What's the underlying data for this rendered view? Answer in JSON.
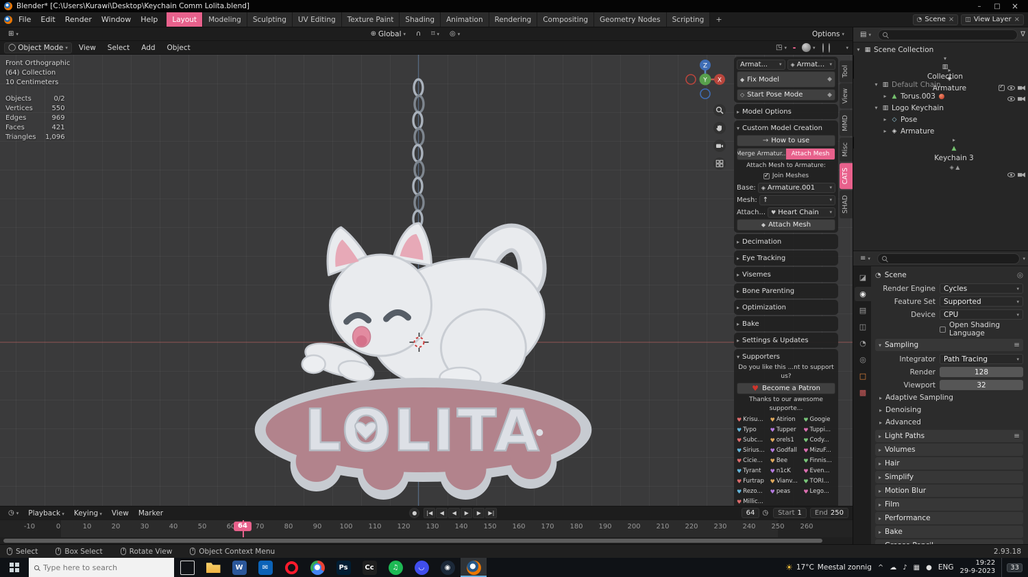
{
  "theme": {
    "accent": "#e8618c"
  },
  "titlebar": {
    "title": "Blender* [C:\\Users\\Kurawi\\Desktop\\Keychain Comm Lolita.blend]"
  },
  "topbar": {
    "menus": [
      {
        "label": "File"
      },
      {
        "label": "Edit"
      },
      {
        "label": "Render"
      },
      {
        "label": "Window"
      },
      {
        "label": "Help"
      }
    ],
    "workspaces": [
      {
        "label": "Layout",
        "active": true
      },
      {
        "label": "Modeling"
      },
      {
        "label": "Sculpting"
      },
      {
        "label": "UV Editing"
      },
      {
        "label": "Texture Paint"
      },
      {
        "label": "Shading"
      },
      {
        "label": "Animation"
      },
      {
        "label": "Rendering"
      },
      {
        "label": "Compositing"
      },
      {
        "label": "Geometry Nodes"
      },
      {
        "label": "Scripting"
      }
    ],
    "add_tab": "+",
    "scene_name": "Scene",
    "view_layer_name": "View Layer"
  },
  "viewport_header": {
    "orientation": "Global",
    "options_label": "Options",
    "mode": "Object Mode",
    "menus": [
      {
        "label": "View"
      },
      {
        "label": "Select"
      },
      {
        "label": "Add"
      },
      {
        "label": "Object"
      }
    ]
  },
  "viewport": {
    "view_label": "Front Orthographic",
    "collection_label": "(64) Collection",
    "scale_label": "10 Centimeters",
    "stats": [
      {
        "label": "Objects",
        "value": "0/2"
      },
      {
        "label": "Vertices",
        "value": "550"
      },
      {
        "label": "Edges",
        "value": "969"
      },
      {
        "label": "Faces",
        "value": "421"
      },
      {
        "label": "Triangles",
        "value": "1,096"
      }
    ],
    "axis_z": "Z",
    "axis_y": "Y",
    "axis_x": "X",
    "model_text": "LOLITA"
  },
  "cats_panel": {
    "armature_label": "Armat...",
    "armature_value": "Armature.001",
    "fix_model": "Fix Model",
    "start_pose_mode": "Start Pose Mode",
    "model_options": "Model Options",
    "custom_model_creation": "Custom Model Creation",
    "how_to_use": "How to use",
    "merge_tab": "Merge Armatur...",
    "attach_tab": "Attach Mesh",
    "attach_heading": "Attach Mesh to Armature:",
    "join_meshes": "Join Meshes",
    "base_label": "Base:",
    "base_value": "Armature.001",
    "mesh_label": "Mesh:",
    "mesh_value": "↑",
    "attach_label": "Attach...",
    "attach_value": "Heart Chain",
    "attach_button": "Attach Mesh",
    "collapsed_sections": [
      "Decimation",
      "Eye Tracking",
      "Visemes",
      "Bone Parenting",
      "Optimization",
      "Bake",
      "Settings & Updates"
    ],
    "supporters_section": "Supporters",
    "support_question": "Do you like this ...nt to support us?",
    "become_patron": "Become a Patron",
    "thanks_line": "Thanks to our awesome supporte...",
    "supporters": [
      "Krisu...",
      "Atirion",
      "Googie",
      "Typo",
      "Tupper",
      "Tuppi...",
      "Subc...",
      "orels1",
      "Cody...",
      "Sirius...",
      "Godfall",
      "MizuF...",
      "Cicie...",
      "Bee",
      "Finnis...",
      "Tyrant",
      "n1cK",
      "Even...",
      "Furtrap",
      "Vianv...",
      "TORI...",
      "Rezo...",
      "peas",
      "Lego...",
      "Millic..."
    ],
    "side_tabs": [
      {
        "label": "Tool"
      },
      {
        "label": "View"
      },
      {
        "label": "MMD"
      },
      {
        "label": "Misc"
      },
      {
        "label": "CATS",
        "active": true
      },
      {
        "label": "SHAD"
      }
    ]
  },
  "outliner": {
    "rows": [
      {
        "label": "Scene Collection",
        "indent": 0,
        "icon": "scene-collection",
        "arrow": "open"
      },
      {
        "label": "Collection",
        "indent": 1,
        "icon": "collection",
        "arrow": "open",
        "right": true,
        "check": true
      },
      {
        "label": "Armature",
        "indent": 2,
        "icon": "armature",
        "arrow": "closed",
        "right": true
      },
      {
        "label": "Default Chain",
        "indent": 2,
        "icon": "collection",
        "arrow": "open",
        "dimmed": true
      },
      {
        "label": "Torus.003",
        "indent": 3,
        "icon": "mesh",
        "arrow": "closed",
        "material": true
      },
      {
        "label": "Logo Keychain",
        "indent": 2,
        "icon": "collection",
        "arrow": "open"
      },
      {
        "label": "Pose",
        "indent": 3,
        "icon": "pose",
        "arrow": "closed"
      },
      {
        "label": "Armature",
        "indent": 3,
        "icon": "armature",
        "arrow": "closed"
      },
      {
        "label": "Keychain 3",
        "indent": 3,
        "icon": "mesh",
        "arrow": "closed",
        "extras": "◈ ▲",
        "right": true
      }
    ]
  },
  "properties": {
    "breadcrumb": "Scene",
    "render_engine_label": "Render Engine",
    "render_engine_value": "Cycles",
    "feature_set_label": "Feature Set",
    "feature_set_value": "Supported",
    "device_label": "Device",
    "device_value": "CPU",
    "osl_label": "Open Shading Language",
    "sampling_title": "Sampling",
    "integrator_label": "Integrator",
    "integrator_value": "Path Tracing",
    "render_label": "Render",
    "render_value": "128",
    "viewport_label": "Viewport",
    "viewport_value": "32",
    "subsections": [
      "Adaptive Sampling",
      "Denoising",
      "Advanced"
    ],
    "sections": [
      {
        "label": "Light Paths",
        "preset": true
      },
      {
        "label": "Volumes"
      },
      {
        "label": "Hair"
      },
      {
        "label": "Simplify"
      },
      {
        "label": "Motion Blur"
      },
      {
        "label": "Film"
      },
      {
        "label": "Performance"
      },
      {
        "label": "Bake"
      },
      {
        "label": "Grease Pencil"
      }
    ],
    "tabs": [
      {
        "name": "tool"
      },
      {
        "name": "render",
        "active": true
      },
      {
        "name": "output"
      },
      {
        "name": "view-layer"
      },
      {
        "name": "scene"
      },
      {
        "name": "world"
      },
      {
        "name": "object"
      },
      {
        "name": "texture"
      }
    ]
  },
  "timeline": {
    "menus": [
      {
        "label": "Playback",
        "chevron": true
      },
      {
        "label": "Keying",
        "chevron": true
      },
      {
        "label": "View"
      },
      {
        "label": "Marker"
      }
    ],
    "transport": [
      {
        "name": "jump-to-start",
        "glyph": "|◀"
      },
      {
        "name": "jump-to-prev-keyframe",
        "glyph": "◀"
      },
      {
        "name": "play-reverse",
        "glyph": "◀"
      },
      {
        "name": "play",
        "glyph": "▶"
      },
      {
        "name": "jump-to-next-keyframe",
        "glyph": "▶"
      },
      {
        "name": "jump-to-end",
        "glyph": "▶|"
      }
    ],
    "current_frame": "64",
    "playhead_frame": "64",
    "start_label": "Start",
    "start_value": "1",
    "end_label": "End",
    "end_value": "250",
    "ticks": [
      "-10",
      "0",
      "10",
      "20",
      "30",
      "40",
      "50",
      "60",
      "70",
      "80",
      "90",
      "100",
      "110",
      "120",
      "130",
      "140",
      "150",
      "160",
      "170",
      "180",
      "190",
      "200",
      "210",
      "220",
      "230",
      "240",
      "250",
      "260"
    ]
  },
  "statusbar": {
    "hints": [
      "Select",
      "Box Select",
      "Rotate View",
      "Object Context Menu"
    ],
    "version": "2.93.18"
  },
  "taskbar": {
    "search_placeholder": "Type here to search",
    "apps": [
      {
        "name": "task-view",
        "glyph": ""
      },
      {
        "name": "file-explorer",
        "glyph": ""
      },
      {
        "name": "word",
        "glyph": "W",
        "color": "#2b579a"
      },
      {
        "name": "mail",
        "glyph": "✉",
        "color": "#0b63b8"
      },
      {
        "name": "opera",
        "glyph": ""
      },
      {
        "name": "chrome",
        "glyph": ""
      },
      {
        "name": "photoshop",
        "glyph": "Ps",
        "color": "#001d33"
      },
      {
        "name": "creative-cloud",
        "glyph": "Cc",
        "color": "#1f1f1f"
      },
      {
        "name": "spotify",
        "glyph": "♫",
        "color": "#1db954"
      },
      {
        "name": "discord",
        "glyph": "◡",
        "color": "#404eed"
      },
      {
        "name": "steam",
        "glyph": "◉",
        "color": "#1b2838"
      },
      {
        "name": "blender",
        "glyph": "",
        "active": true
      }
    ],
    "weather_temp": "17°C",
    "weather_desc": "Meestal zonnig",
    "tray_icons": [
      {
        "name": "tray-expand",
        "glyph": "^"
      },
      {
        "name": "onedrive",
        "glyph": "☁"
      },
      {
        "name": "volume",
        "glyph": "♪"
      },
      {
        "name": "display",
        "glyph": "▦"
      },
      {
        "name": "network",
        "glyph": "●"
      }
    ],
    "language": "ENG",
    "time": "19:22",
    "date": "29-9-2023",
    "badge": "33"
  }
}
